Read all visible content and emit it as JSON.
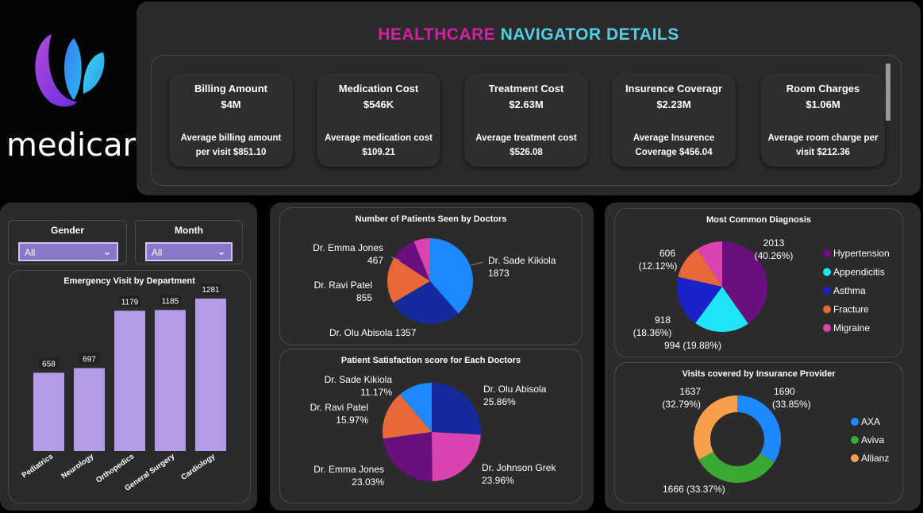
{
  "header": {
    "title_part1": "HEALTHCARE",
    "title_part2": "NAVIGATOR DETAILS",
    "title_color1": "#d61fa3",
    "title_color2": "#4fd0e6"
  },
  "logo": {
    "text": "medicare"
  },
  "kpis": [
    {
      "title": "Billing Amount",
      "value": "$4M",
      "desc1": "Average billing amount",
      "desc2": "per visit $851.10"
    },
    {
      "title": "Medication Cost",
      "value": "$546K",
      "desc1": "Average medication cost",
      "desc2": "$109.21"
    },
    {
      "title": "Treatment Cost",
      "value": "$2.63M",
      "desc1": "Average treatment cost",
      "desc2": "$526.08"
    },
    {
      "title": "Insurence Coveragr",
      "value": "$2.23M",
      "desc1": "Average Insurence",
      "desc2": "Coverage $456.04"
    },
    {
      "title": "Room Charges",
      "value": "$1.06M",
      "desc1": "Average room charge per",
      "desc2": "visit $212.36"
    }
  ],
  "slicers": {
    "gender": {
      "label": "Gender",
      "value": "All"
    },
    "month": {
      "label": "Month",
      "value": "All"
    }
  },
  "chart_data": [
    {
      "type": "bar",
      "title": "Emergency Visit by Department",
      "categories": [
        "Pediatrics",
        "Neurology",
        "Orthopedics",
        "General Surgery",
        "Cardiology"
      ],
      "values": [
        658,
        697,
        1179,
        1185,
        1281
      ],
      "value_labels": [
        "658",
        "697",
        "1179",
        "1185",
        "1281"
      ],
      "color": "#b39be8"
    },
    {
      "type": "pie",
      "title": "Number of Patients Seen by Doctors",
      "slices": [
        {
          "name": "Dr. Sade Kikiola",
          "value": 1873,
          "label": "1873",
          "color": "#1e88ff"
        },
        {
          "name": "Dr. Olu Abisola",
          "value": 1357,
          "label": "1357",
          "color": "#152a9c"
        },
        {
          "name": "Dr. Ravi Patel",
          "value": 855,
          "label": "855",
          "color": "#e8683a"
        },
        {
          "name": "Dr. Emma Jones",
          "value": 467,
          "label": "467",
          "color": "#6a0f80"
        },
        {
          "name": "Dr. Johnson Grek",
          "value": 300,
          "label": "",
          "color": "#d944b0"
        }
      ]
    },
    {
      "type": "pie",
      "title": "Patient Satisfaction score for Each Doctors",
      "slices": [
        {
          "name": "Dr. Olu Abisola",
          "value": 25.86,
          "label": "25.86%",
          "color": "#152a9c"
        },
        {
          "name": "Dr. Johnson Grek",
          "value": 23.96,
          "label": "23.96%",
          "color": "#d944b0"
        },
        {
          "name": "Dr. Emma Jones",
          "value": 23.03,
          "label": "23.03%",
          "color": "#6a0f80"
        },
        {
          "name": "Dr. Ravi Patel",
          "value": 15.97,
          "label": "15.97%",
          "color": "#e8683a"
        },
        {
          "name": "Dr. Sade Kikiola",
          "value": 11.17,
          "label": "11.17%",
          "color": "#1e88ff"
        }
      ]
    },
    {
      "type": "pie",
      "title": "Most Common Diagnosis",
      "slices": [
        {
          "name": "Hypertension",
          "value": 2013,
          "label1": "2013",
          "label2": "(40.26%)",
          "color": "#6a0f80"
        },
        {
          "name": "Appendicitis",
          "value": 994,
          "label1": "994 (19.88%)",
          "label2": "",
          "color": "#1ee4f5"
        },
        {
          "name": "Asthma",
          "value": 918,
          "label1": "918",
          "label2": "(18.36%)",
          "color": "#1a22c8"
        },
        {
          "name": "Fracture",
          "value": 606,
          "label1": "606",
          "label2": "(12.12%)",
          "color": "#e8683a"
        },
        {
          "name": "Migraine",
          "value": 470,
          "label1": "",
          "label2": "",
          "color": "#d944b0"
        }
      ]
    },
    {
      "type": "pie",
      "title": "Visits covered by Insurance Provider",
      "donut": true,
      "slices": [
        {
          "name": "AXA",
          "value": 1690,
          "label1": "1690",
          "label2": "(33.85%)",
          "color": "#1e88ff"
        },
        {
          "name": "Aviva",
          "value": 1666,
          "label1": "1666 (33.37%)",
          "label2": "",
          "color": "#3aa832"
        },
        {
          "name": "Allianz",
          "value": 1637,
          "label1": "1637",
          "label2": "(32.79%)",
          "color": "#f7a04b"
        }
      ]
    }
  ]
}
